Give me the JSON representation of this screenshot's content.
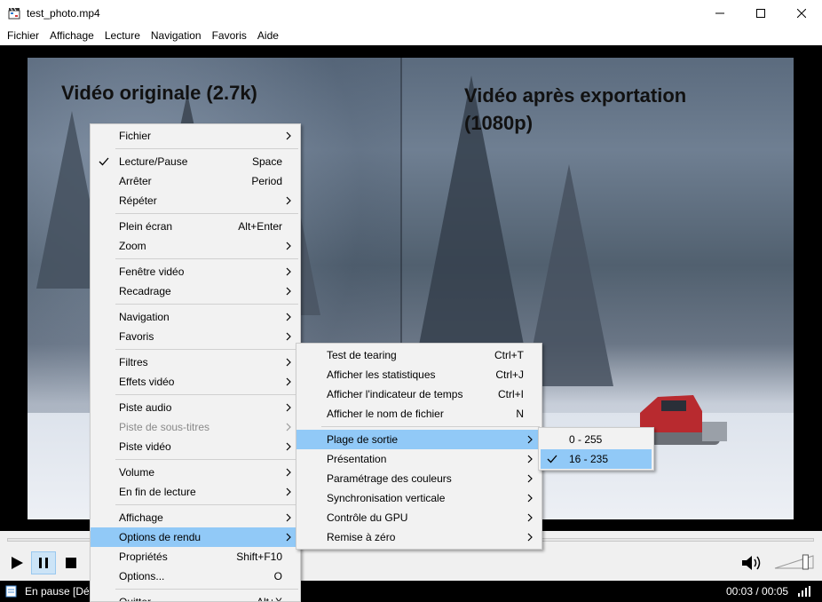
{
  "window": {
    "title": "test_photo.mp4",
    "icon": "clapperboard-icon"
  },
  "menubar": [
    "Fichier",
    "Affichage",
    "Lecture",
    "Navigation",
    "Favoris",
    "Aide"
  ],
  "video": {
    "caption_left": "Vidéo originale (2.7k)",
    "caption_right": "Vidéo après exportation (1080p)"
  },
  "context_menu": {
    "items": [
      {
        "label": "Fichier",
        "shortcut": "",
        "submenu": true
      },
      {
        "separator": true
      },
      {
        "label": "Lecture/Pause",
        "shortcut": "Space",
        "checked": true
      },
      {
        "label": "Arrêter",
        "shortcut": "Period"
      },
      {
        "label": "Répéter",
        "shortcut": "",
        "submenu": true
      },
      {
        "separator": true
      },
      {
        "label": "Plein écran",
        "shortcut": "Alt+Enter"
      },
      {
        "label": "Zoom",
        "shortcut": "",
        "submenu": true
      },
      {
        "separator": true
      },
      {
        "label": "Fenêtre vidéo",
        "shortcut": "",
        "submenu": true
      },
      {
        "label": "Recadrage",
        "shortcut": "",
        "submenu": true
      },
      {
        "separator": true
      },
      {
        "label": "Navigation",
        "shortcut": "",
        "submenu": true
      },
      {
        "label": "Favoris",
        "shortcut": "",
        "submenu": true
      },
      {
        "separator": true
      },
      {
        "label": "Filtres",
        "shortcut": "",
        "submenu": true
      },
      {
        "label": "Effets vidéo",
        "shortcut": "",
        "submenu": true
      },
      {
        "separator": true
      },
      {
        "label": "Piste audio",
        "shortcut": "",
        "submenu": true
      },
      {
        "label": "Piste de sous-titres",
        "shortcut": "",
        "submenu": true,
        "disabled": true
      },
      {
        "label": "Piste vidéo",
        "shortcut": "",
        "submenu": true
      },
      {
        "separator": true
      },
      {
        "label": "Volume",
        "shortcut": "",
        "submenu": true
      },
      {
        "label": "En fin de lecture",
        "shortcut": "",
        "submenu": true
      },
      {
        "separator": true
      },
      {
        "label": "Affichage",
        "shortcut": "",
        "submenu": true
      },
      {
        "label": "Options de rendu",
        "shortcut": "",
        "submenu": true,
        "highlighted": true
      },
      {
        "label": "Propriétés",
        "shortcut": "Shift+F10"
      },
      {
        "label": "Options...",
        "shortcut": "O"
      },
      {
        "separator": true
      },
      {
        "label": "Quitter",
        "shortcut": "Alt+X"
      }
    ]
  },
  "render_submenu": {
    "items": [
      {
        "label": "Test de tearing",
        "shortcut": "Ctrl+T"
      },
      {
        "label": "Afficher les statistiques",
        "shortcut": "Ctrl+J"
      },
      {
        "label": "Afficher l'indicateur de temps",
        "shortcut": "Ctrl+I"
      },
      {
        "label": "Afficher le nom de fichier",
        "shortcut": "N"
      },
      {
        "separator": true
      },
      {
        "label": "Plage de sortie",
        "shortcut": "",
        "submenu": true,
        "highlighted": true
      },
      {
        "label": "Présentation",
        "shortcut": "",
        "submenu": true
      },
      {
        "label": "Paramétrage des couleurs",
        "shortcut": "",
        "submenu": true
      },
      {
        "label": "Synchronisation verticale",
        "shortcut": "",
        "submenu": true
      },
      {
        "label": "Contrôle du GPU",
        "shortcut": "",
        "submenu": true
      },
      {
        "label": "Remise à zéro",
        "shortcut": "",
        "submenu": true
      }
    ]
  },
  "range_submenu": {
    "items": [
      {
        "label": "0 - 255"
      },
      {
        "label": "16 - 235",
        "checked": true,
        "highlighted": true
      }
    ]
  },
  "controls": {
    "seek_progress": 0.6,
    "volume_level": 0.8
  },
  "statusbar": {
    "status": "En pause [Décodage",
    "time": "00:03 / 00:05"
  },
  "colors": {
    "menu_highlight": "#91c9f7",
    "menu_background": "#f2f2f2",
    "statusbar_background": "#000000",
    "video_background": "#000000"
  }
}
